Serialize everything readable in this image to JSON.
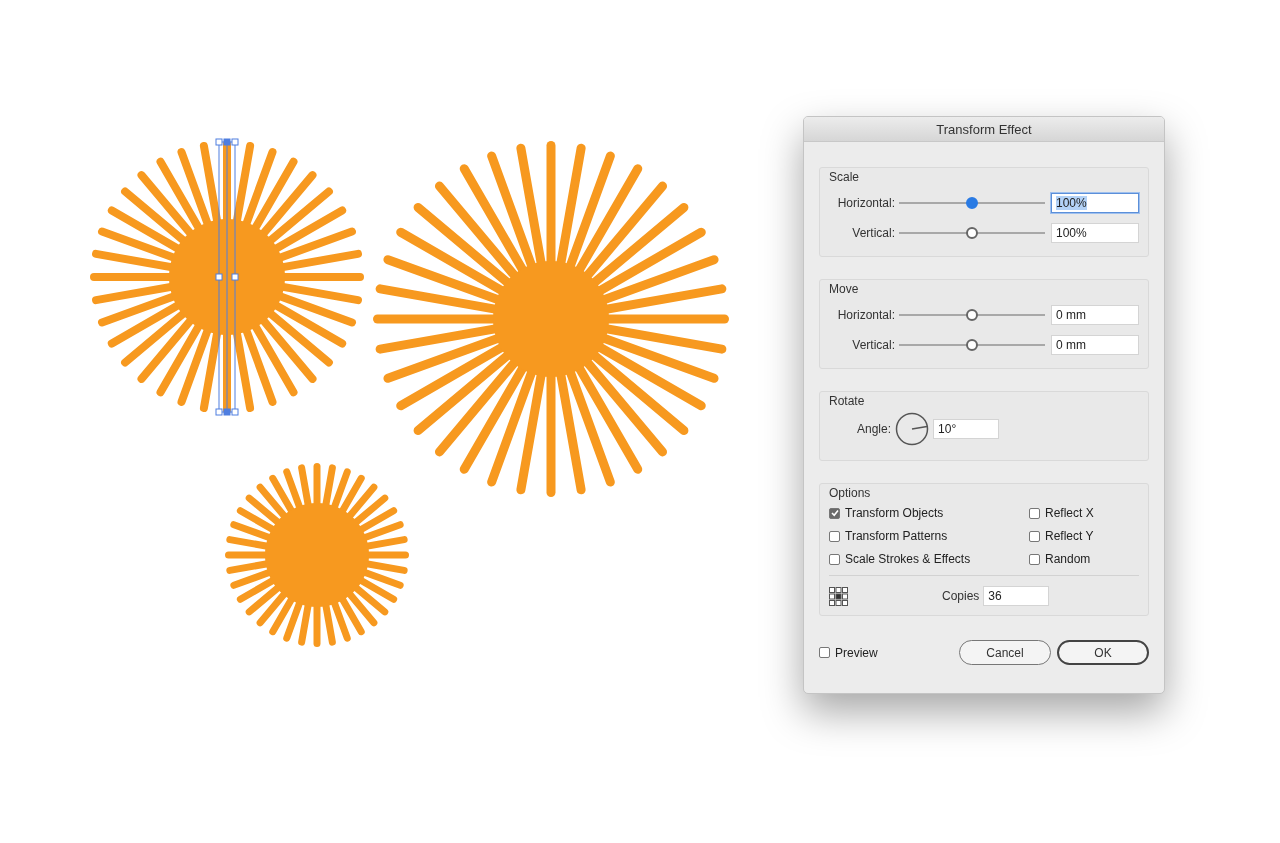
{
  "dialog": {
    "title": "Transform Effect",
    "groups": [
      {
        "title": "Scale",
        "rows": [
          {
            "label": "Horizontal:",
            "level": 0.5,
            "active": true,
            "value": "100%",
            "focused": true
          },
          {
            "label": "Vertical:",
            "level": 0.5,
            "active": false,
            "value": "100%",
            "focused": false
          }
        ]
      },
      {
        "title": "Move",
        "rows": [
          {
            "label": "Horizontal:",
            "level": 0.5,
            "active": false,
            "value": "0 mm",
            "focused": false
          },
          {
            "label": "Vertical:",
            "level": 0.5,
            "active": false,
            "value": "0 mm",
            "focused": false
          }
        ]
      }
    ],
    "rotate": {
      "title": "Rotate",
      "label": "Angle:",
      "value": "10°"
    },
    "options": {
      "title": "Options",
      "checkboxes": [
        {
          "label": "Transform Objects",
          "checked": true
        },
        {
          "label": "Reflect X",
          "checked": false
        },
        {
          "label": "Transform Patterns",
          "checked": false
        },
        {
          "label": "Reflect Y",
          "checked": false
        },
        {
          "label": "Scale Strokes & Effects",
          "checked": false
        },
        {
          "label": "Random",
          "checked": false
        }
      ],
      "copies_label": "Copies",
      "copies": "36"
    },
    "preview": {
      "label": "Preview",
      "checked": false
    },
    "buttons": [
      {
        "label": "Cancel",
        "default": false
      },
      {
        "label": "OK",
        "default": true
      }
    ]
  }
}
